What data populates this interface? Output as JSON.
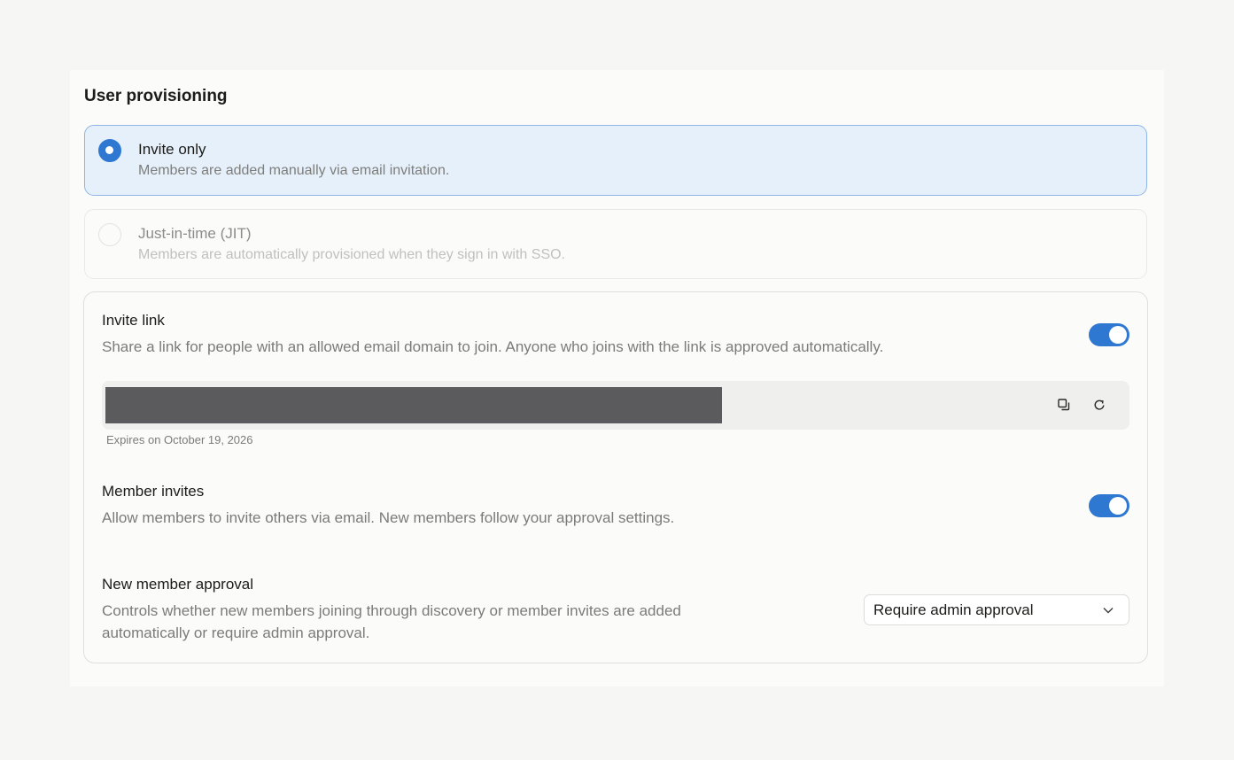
{
  "section_title": "User provisioning",
  "options": [
    {
      "title": "Invite only",
      "description": "Members are added manually via email invitation.",
      "selected": true
    },
    {
      "title": "Just-in-time (JIT)",
      "description": "Members are automatically provisioned when they sign in with SSO.",
      "selected": false,
      "disabled": true
    }
  ],
  "invite_link": {
    "title": "Invite link",
    "description": "Share a link for people with an allowed email domain to join. Anyone who joins with the link is approved automatically.",
    "enabled": true,
    "expires": "Expires on October 19, 2026",
    "copy_icon": "copy-icon",
    "regenerate_icon": "refresh-icon"
  },
  "member_invites": {
    "title": "Member invites",
    "description": "Allow members to invite others via email. New members follow your approval settings.",
    "enabled": true
  },
  "new_member_approval": {
    "title": "New member approval",
    "description_line1": "Controls whether new members joining through discovery or member invites are added",
    "description_line2": "automatically or require admin approval.",
    "selected": "Require admin approval",
    "chevron_icon": "chevron-down-icon"
  },
  "colors": {
    "accent": "#2e78d2",
    "selected_bg": "#e6f0fb",
    "selected_border": "#8db6e6",
    "page_bg": "#f6f6f5"
  }
}
